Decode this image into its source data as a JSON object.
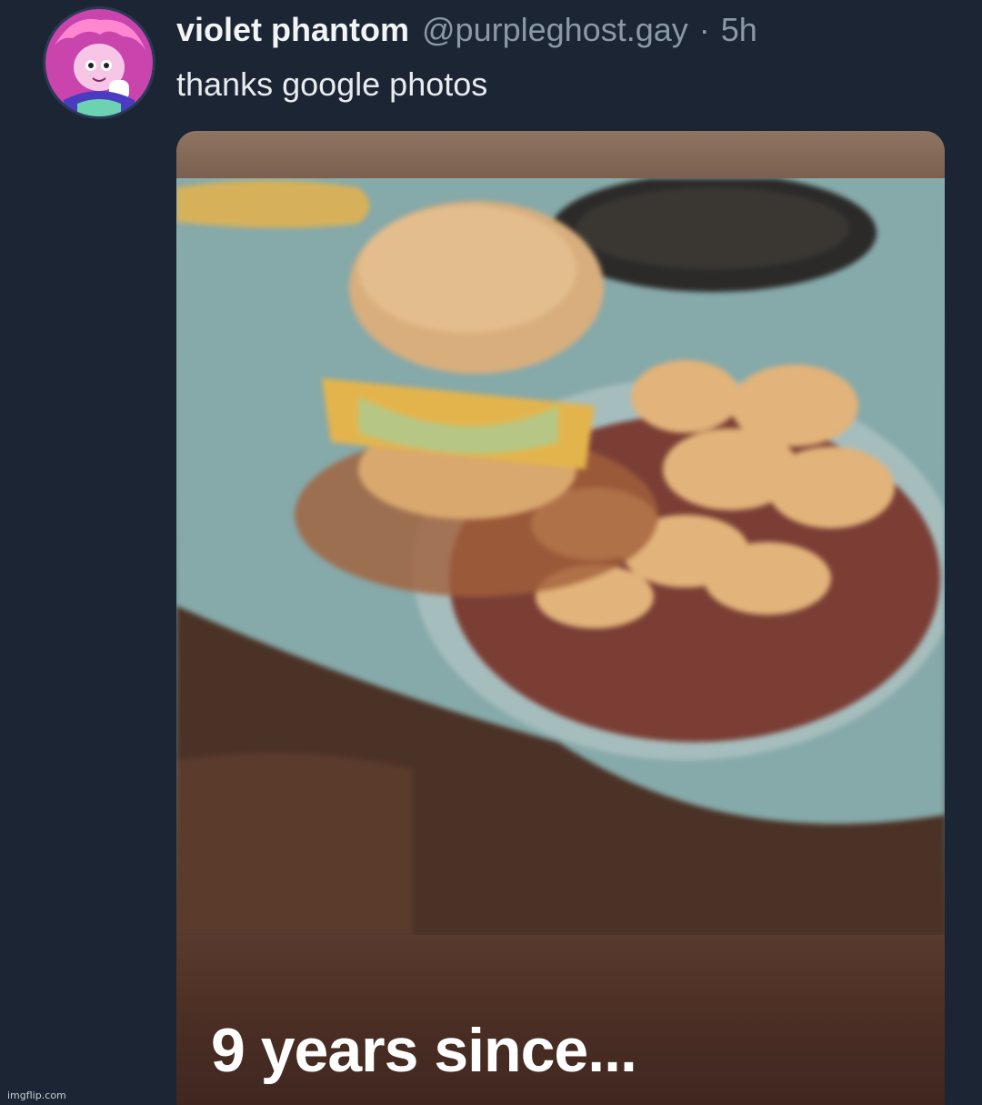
{
  "post": {
    "display_name": "violet phantom",
    "handle": "@purpleghost.gay",
    "separator": "·",
    "timestamp": "5h",
    "text": "thanks google photos"
  },
  "media": {
    "caption": "9 years since..."
  },
  "watermark": {
    "text": "imgflip.com"
  }
}
